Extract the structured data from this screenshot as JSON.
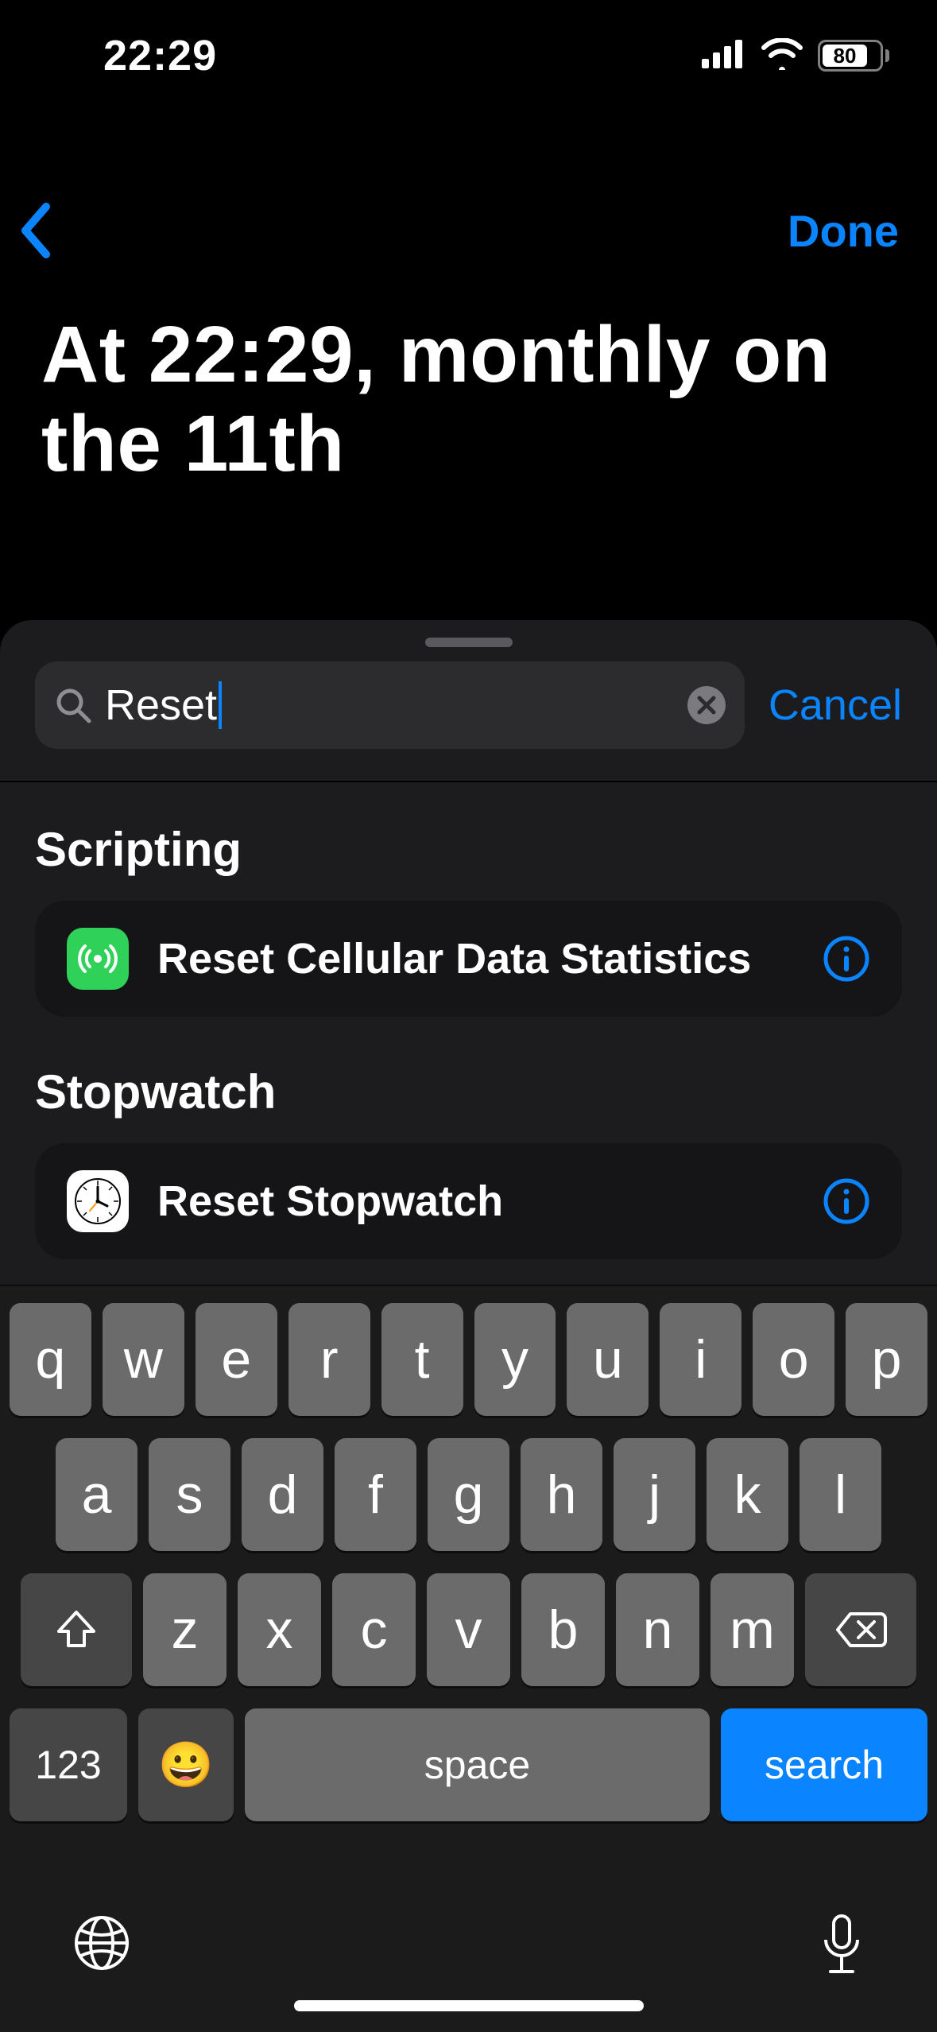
{
  "statusbar": {
    "time": "22:29",
    "battery_pct": "80"
  },
  "nav": {
    "done_label": "Done"
  },
  "page_title": "At 22:29, monthly on the 11th",
  "search": {
    "value": "Reset",
    "cancel_label": "Cancel"
  },
  "sections": [
    {
      "title": "Scripting",
      "action": {
        "label": "Reset Cellular Data Statistics",
        "icon": "cellular"
      }
    },
    {
      "title": "Stopwatch",
      "action": {
        "label": "Reset Stopwatch",
        "icon": "clock"
      }
    }
  ],
  "keyboard": {
    "row1": [
      "q",
      "w",
      "e",
      "r",
      "t",
      "y",
      "u",
      "i",
      "o",
      "p"
    ],
    "row2": [
      "a",
      "s",
      "d",
      "f",
      "g",
      "h",
      "j",
      "k",
      "l"
    ],
    "row3": [
      "z",
      "x",
      "c",
      "v",
      "b",
      "n",
      "m"
    ],
    "numeric_label": "123",
    "space_label": "space",
    "search_label": "search"
  }
}
